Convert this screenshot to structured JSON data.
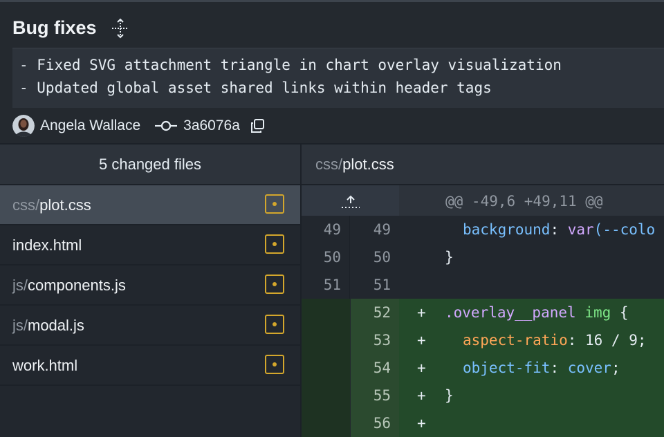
{
  "commit": {
    "title": "Bug fixes",
    "message_lines": [
      "- Fixed SVG attachment triangle in chart overlay visualization",
      "- Updated global asset shared links within header tags"
    ],
    "author": "Angela Wallace",
    "sha": "3a6076a"
  },
  "files_panel": {
    "header": "5 changed files",
    "files": [
      {
        "dir": "css/",
        "name": "plot.css",
        "status": "modified"
      },
      {
        "dir": "",
        "name": "index.html",
        "status": "modified"
      },
      {
        "dir": "js/",
        "name": "components.js",
        "status": "modified"
      },
      {
        "dir": "js/",
        "name": "modal.js",
        "status": "modified"
      },
      {
        "dir": "",
        "name": "work.html",
        "status": "modified"
      }
    ]
  },
  "diff": {
    "file_dir": "css/",
    "file_name": "plot.css",
    "hunk_header": "@@ -49,6 +49,11 @@",
    "lines": [
      {
        "old": "49",
        "new": "49",
        "sign": "",
        "tokens": {
          "p1": "background",
          "p2": ": ",
          "p3": "var",
          "p4": "(--colo"
        }
      },
      {
        "old": "50",
        "new": "50",
        "sign": "",
        "text": "}"
      },
      {
        "old": "51",
        "new": "51",
        "sign": "",
        "text": ""
      },
      {
        "old": "",
        "new": "52",
        "sign": "+",
        "tokens": {
          "p1": ".overlay__panel",
          "p2": " ",
          "p3": "img",
          "p4": " {"
        }
      },
      {
        "old": "",
        "new": "53",
        "sign": "+",
        "tokens": {
          "p1": "aspect-ratio",
          "p2": ": 16 / 9;"
        }
      },
      {
        "old": "",
        "new": "54",
        "sign": "+",
        "tokens": {
          "p1": "object-fit",
          "p2": ": ",
          "p3": "cover",
          "p4": ";"
        }
      },
      {
        "old": "",
        "new": "55",
        "sign": "+",
        "text": "}"
      },
      {
        "old": "",
        "new": "56",
        "sign": "+",
        "text": ""
      }
    ]
  },
  "colors": {
    "modified_badge": "#d4a72c",
    "added_bg": "#234a2a",
    "selected_row": "#444c56"
  },
  "icons": {
    "move": "move-icon",
    "commit": "commit-icon",
    "copy": "copy-icon",
    "expand": "expand-up-icon",
    "modified": "file-modified-icon"
  }
}
